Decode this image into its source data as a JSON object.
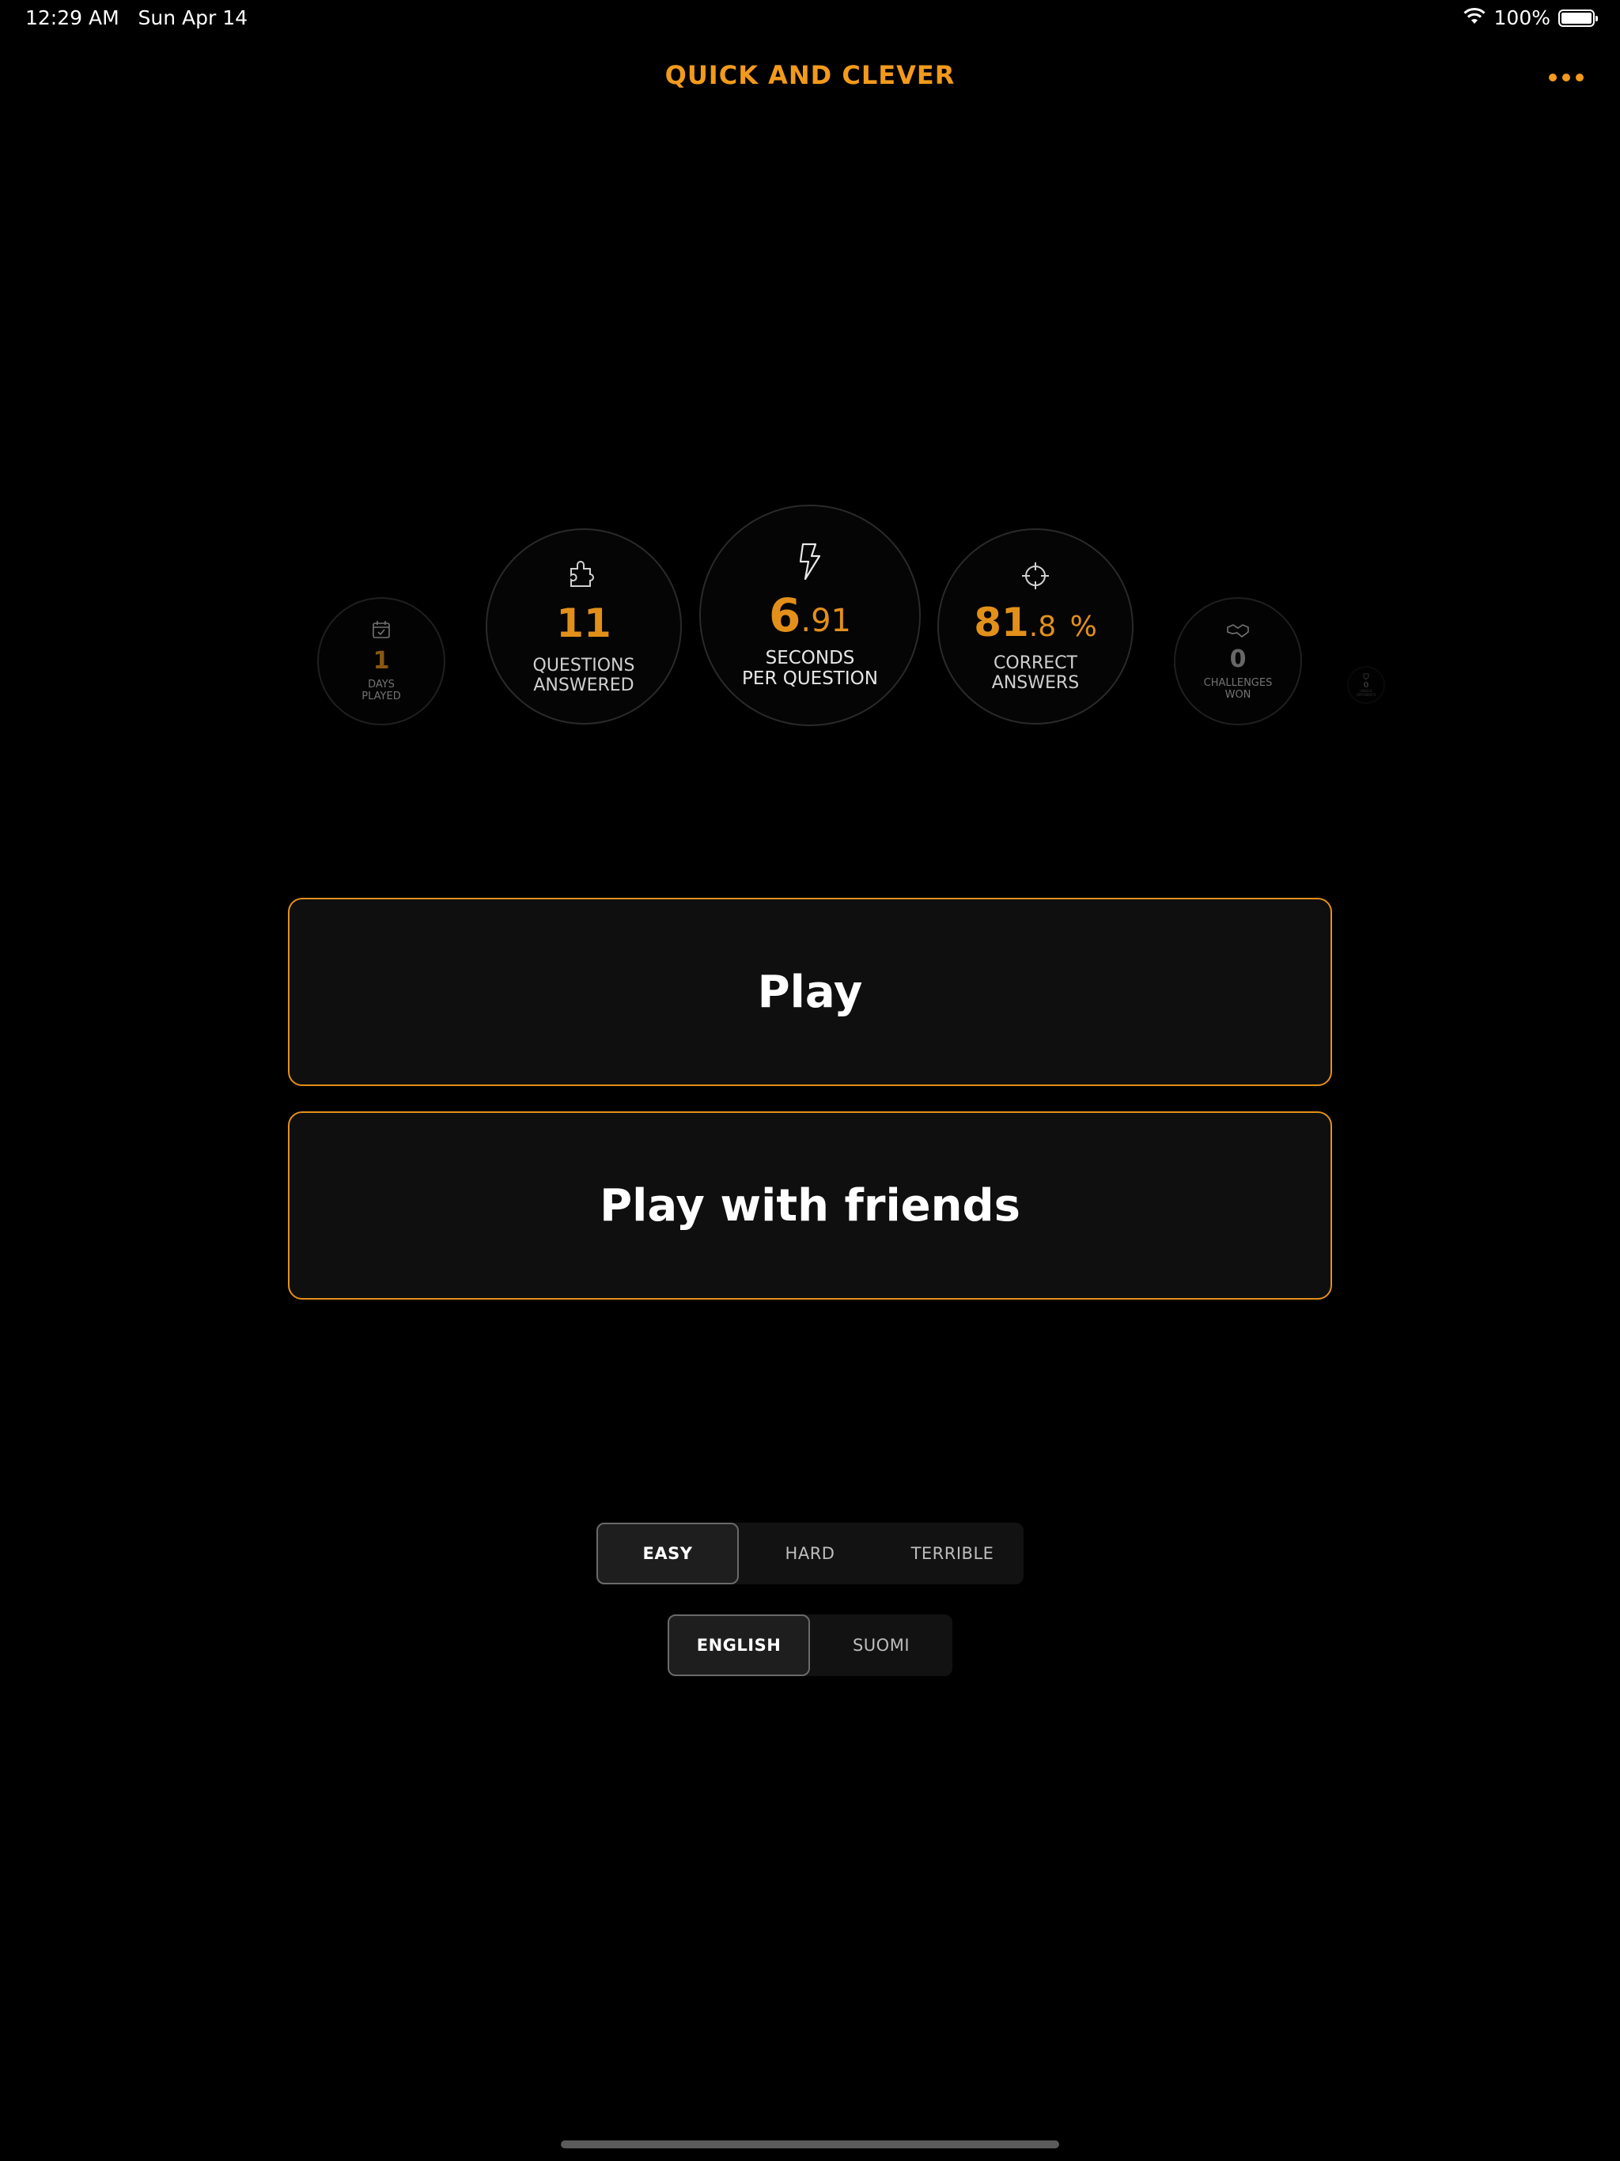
{
  "status_bar": {
    "time": "12:29 AM",
    "date": "Sun Apr 14",
    "battery_percent": "100%",
    "battery_level": 1.0
  },
  "header": {
    "title": "QUICK AND CLEVER",
    "more_icon": "ellipsis-icon"
  },
  "stats": {
    "days_played": {
      "value": "1",
      "label_line1": "DAYS",
      "label_line2": "PLAYED",
      "icon": "calendar-check-icon"
    },
    "questions_answered": {
      "value": "11",
      "label_line1": "QUESTIONS",
      "label_line2": "ANSWERED",
      "icon": "puzzle-piece-icon"
    },
    "seconds_per_question": {
      "value_main": "6",
      "value_decimal": ".91",
      "label_line1": "SECONDS",
      "label_line2": "PER QUESTION",
      "icon": "lightning-bolt-icon"
    },
    "correct_answers": {
      "value_main": "81",
      "value_decimal": ".8",
      "value_unit": "%",
      "label_line1": "CORRECT",
      "label_line2": "ANSWERS",
      "icon": "crosshair-icon"
    },
    "challenges_won": {
      "value": "0",
      "label_line1": "CHALLENGES",
      "label_line2": "WON",
      "icon": "handshake-icon"
    },
    "unique_opponents": {
      "value": "0",
      "label_line1": "UNIQUE",
      "label_line2": "OPPONENTS",
      "icon": "trophy-icon"
    }
  },
  "actions": {
    "play_label": "Play",
    "play_with_friends_label": "Play with friends"
  },
  "difficulty": {
    "options": [
      "EASY",
      "HARD",
      "TERRIBLE"
    ],
    "selected": "EASY"
  },
  "language": {
    "options": [
      "ENGLISH",
      "SUOMI"
    ],
    "selected": "ENGLISH"
  },
  "colors": {
    "accent": "#f29a1c",
    "background": "#000000"
  }
}
